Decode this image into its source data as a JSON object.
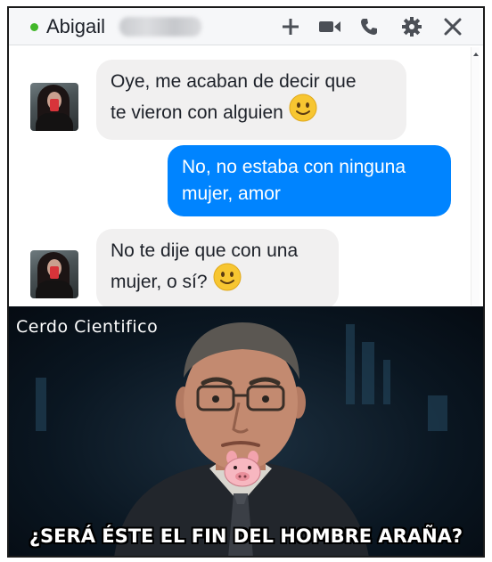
{
  "window": {
    "contact_name": "Abigail",
    "online": true,
    "toolbar_icons": [
      "add-icon",
      "video-call-icon",
      "phone-icon",
      "gear-icon",
      "close-icon"
    ]
  },
  "messages": [
    {
      "direction": "incoming",
      "lines": [
        "Oye, me acaban de decir que",
        "te vieron con alguien"
      ],
      "emoji": "slightly-smiling-face"
    },
    {
      "direction": "outgoing",
      "lines": [
        "No, no estaba con ninguna",
        "mujer, amor"
      ]
    },
    {
      "direction": "incoming",
      "lines": [
        "No te dije que con una",
        "mujer, o sí?"
      ],
      "emoji": "slightly-smiling-face"
    }
  ],
  "meme": {
    "watermark": "Cerdo Cientifico",
    "caption": "¿SERÁ ÉSTE EL FIN DEL HOMBRE ARAÑA?"
  },
  "colors": {
    "online_dot": "#42b72a",
    "incoming_bubble": "#f1f0f0",
    "outgoing_bubble": "#0084ff",
    "toolbar_icon": "#4b4f56"
  }
}
